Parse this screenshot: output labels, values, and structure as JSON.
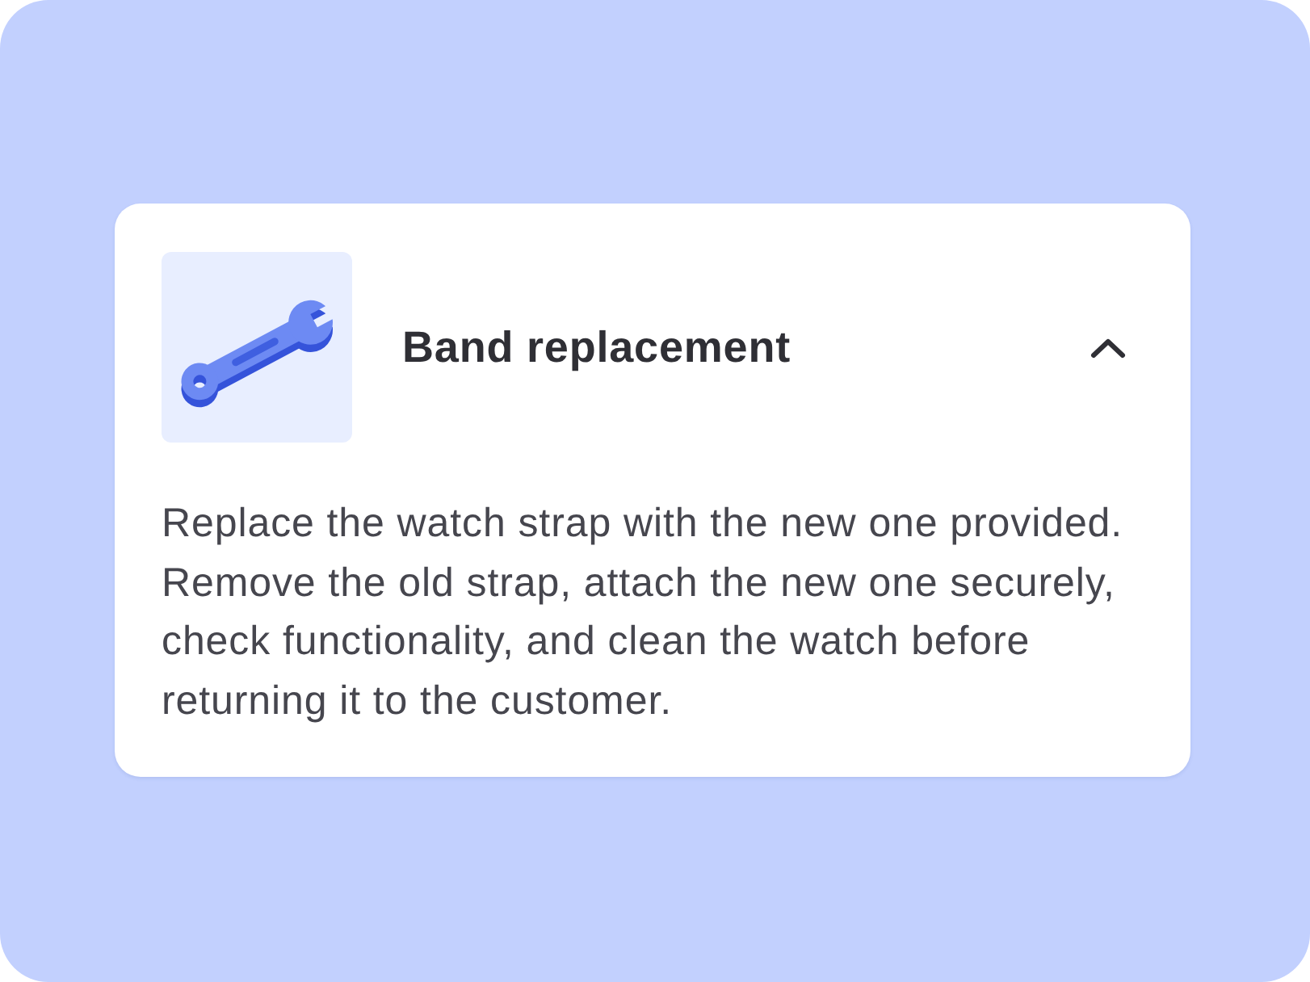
{
  "card": {
    "title": "Band replacement",
    "expanded": true,
    "description": "Replace the watch strap with the new one provided. Remove the old strap, attach the new one securely, check functionality, and clean the watch before returning it to the customer."
  }
}
